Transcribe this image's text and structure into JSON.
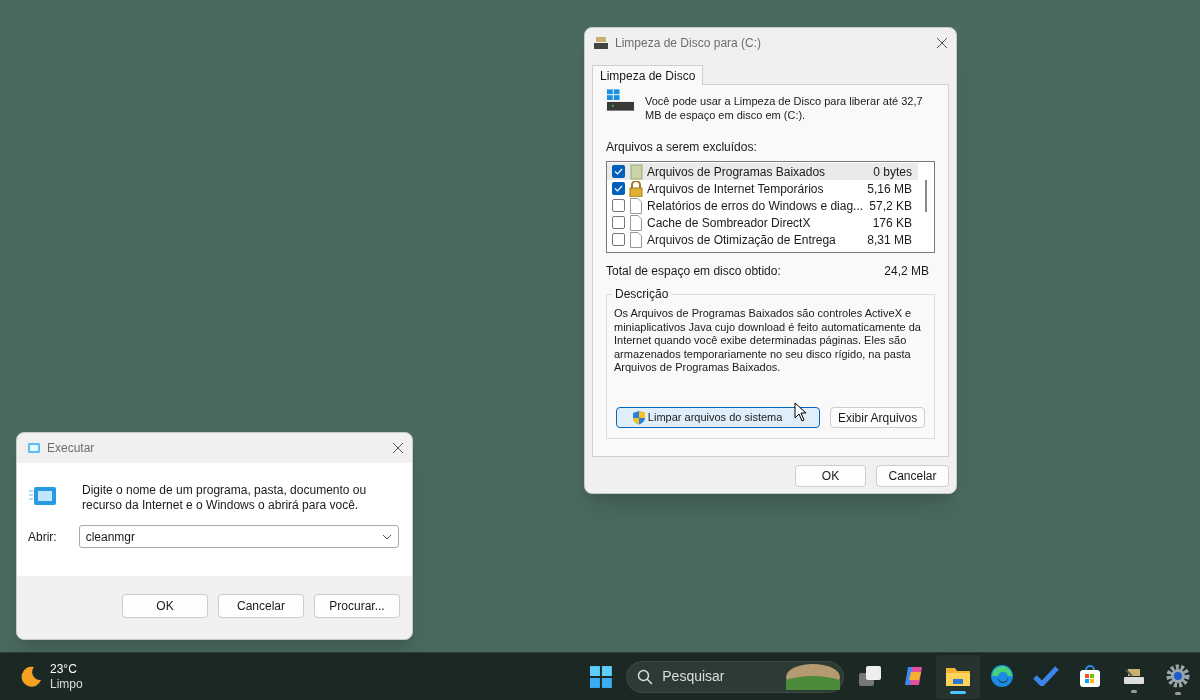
{
  "disk_cleanup": {
    "title": "Limpeza de Disco para  (C:)",
    "tabs": [
      {
        "label": "Limpeza de Disco",
        "selected": true
      }
    ],
    "intro": "Você pode usar a Limpeza de Disco para liberar até 32,7 MB de espaço em disco em  (C:).",
    "files_label": "Arquivos a serem excluídos:",
    "files": [
      {
        "name": "Arquivos de Programas Baixados",
        "size": "0 bytes",
        "checked": true,
        "selected": true,
        "kind": "folder"
      },
      {
        "name": "Arquivos de Internet Temporários",
        "size": "5,16 MB",
        "checked": true,
        "selected": false,
        "kind": "lock"
      },
      {
        "name": "Relatórios de erros do Windows e diag...",
        "size": "57,2 KB",
        "checked": false,
        "selected": false,
        "kind": "document"
      },
      {
        "name": "Cache de Sombreador DirectX",
        "size": "176 KB",
        "checked": false,
        "selected": false,
        "kind": "document"
      },
      {
        "name": "Arquivos de Otimização de Entrega",
        "size": "8,31 MB",
        "checked": false,
        "selected": false,
        "kind": "document"
      }
    ],
    "total_label": "Total de espaço em disco obtido:",
    "total_value": "24,2 MB",
    "description_title": "Descrição",
    "description": "Os Arquivos de Programas Baixados são controles ActiveX e miniaplicativos Java cujo download é feito automaticamente da Internet quando você exibe determinadas páginas. Eles são armazenados temporariamente no seu disco rígido, na pasta Arquivos de Programas Baixados.",
    "clean_system_button": "Limpar arquivos do sistema",
    "view_files_button": "Exibir Arquivos",
    "ok_button": "OK",
    "cancel_button": "Cancelar"
  },
  "run": {
    "title": "Executar",
    "prompt": "Digite o nome de um programa, pasta, documento ou recurso da Internet e o Windows o abrirá para você.",
    "open_label": "Abrir:",
    "open_value": "cleanmgr",
    "buttons": [
      "OK",
      "Cancelar",
      "Procurar..."
    ]
  },
  "taskbar": {
    "temperature": "23°C",
    "condition": "Limpo",
    "search_placeholder": "Pesquisar",
    "apps": [
      {
        "kind": "task-view",
        "running": false,
        "active": false
      },
      {
        "kind": "copilot",
        "running": false,
        "active": false
      },
      {
        "kind": "folder",
        "running": true,
        "active": true
      },
      {
        "kind": "browser",
        "running": false,
        "active": false
      },
      {
        "kind": "todo",
        "running": false,
        "active": false
      },
      {
        "kind": "store",
        "running": false,
        "active": false
      },
      {
        "kind": "disk-cleanup",
        "running": true,
        "active": false
      },
      {
        "kind": "settings",
        "running": true,
        "active": false
      }
    ]
  }
}
